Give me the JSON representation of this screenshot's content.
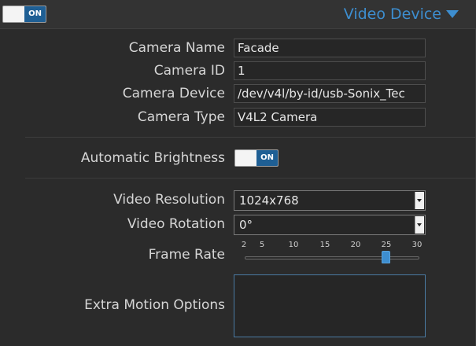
{
  "header": {
    "toggle_label": "ON",
    "title": "Video Device"
  },
  "fields": {
    "camera_name": {
      "label": "Camera Name",
      "value": "Facade"
    },
    "camera_id": {
      "label": "Camera ID",
      "value": "1"
    },
    "camera_device": {
      "label": "Camera Device",
      "value": "/dev/v4l/by-id/usb-Sonix_Tec"
    },
    "camera_type": {
      "label": "Camera Type",
      "value": "V4L2 Camera"
    }
  },
  "automatic_brightness": {
    "label": "Automatic Brightness",
    "toggle_label": "ON"
  },
  "video_resolution": {
    "label": "Video Resolution",
    "value": "1024x768"
  },
  "video_rotation": {
    "label": "Video Rotation",
    "value": "0°"
  },
  "frame_rate": {
    "label": "Frame Rate",
    "ticks": [
      "2",
      "5",
      "10",
      "15",
      "20",
      "25",
      "30"
    ],
    "value": 25
  },
  "extra_motion_options": {
    "label": "Extra Motion Options",
    "value": ""
  },
  "colors": {
    "accent": "#3d8ed0",
    "toggle_on": "#1f5f94",
    "background": "#2b2b2b"
  }
}
